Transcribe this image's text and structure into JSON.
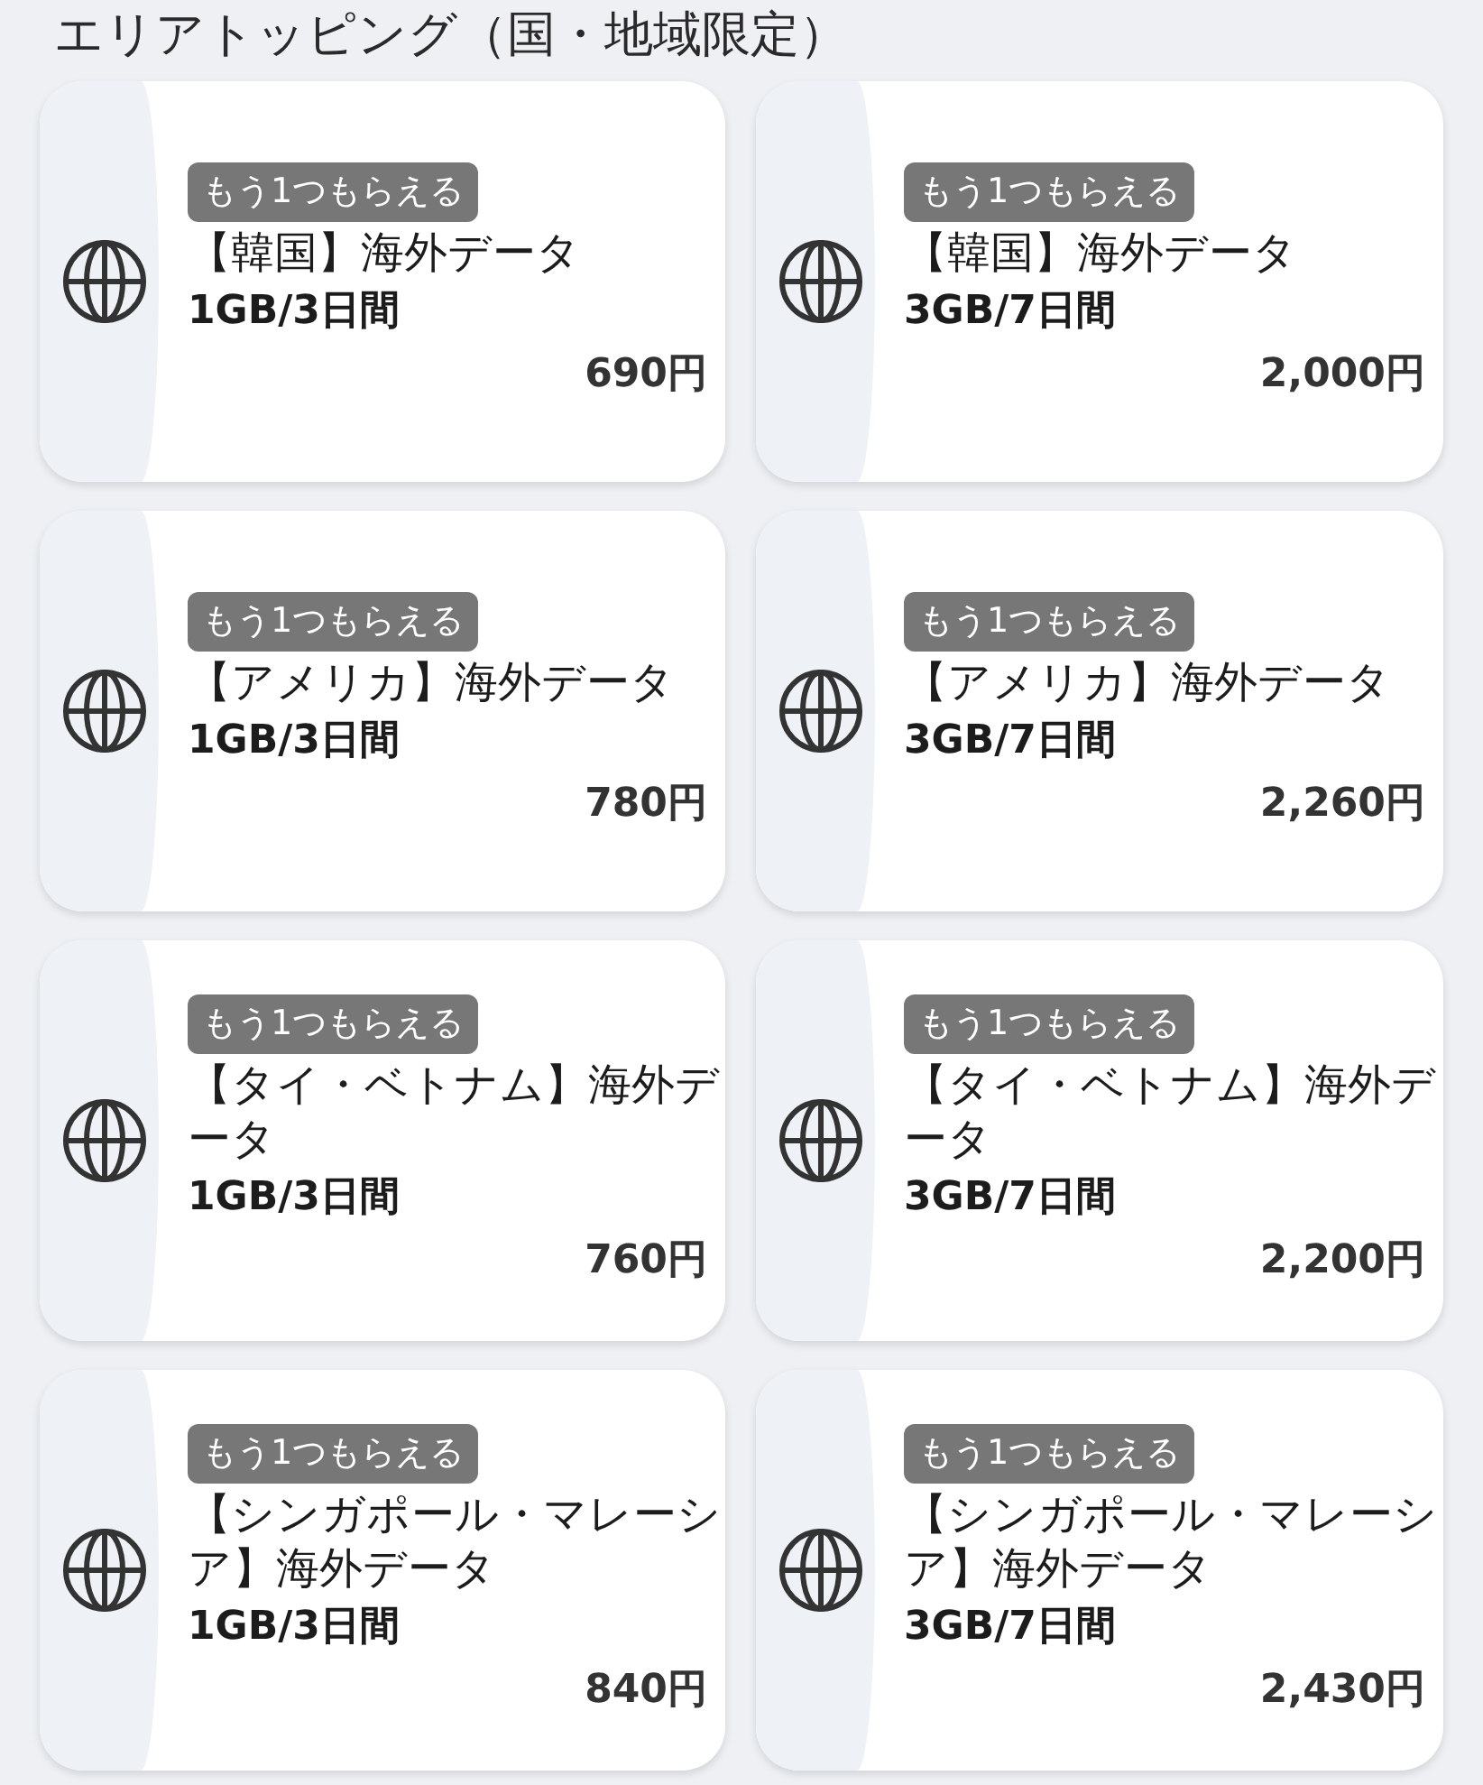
{
  "heading": "エリアトッピング（国・地域限定）",
  "cards": [
    {
      "badge": "もう1つもらえる",
      "title": "【韓国】海外データ",
      "plan": "1GB/3日間",
      "price": "690円"
    },
    {
      "badge": "もう1つもらえる",
      "title": "【韓国】海外データ",
      "plan": "3GB/7日間",
      "price": "2,000円"
    },
    {
      "badge": "もう1つもらえる",
      "title": "【アメリカ】海外データ",
      "plan": "1GB/3日間",
      "price": "780円"
    },
    {
      "badge": "もう1つもらえる",
      "title": "【アメリカ】海外データ",
      "plan": "3GB/7日間",
      "price": "2,260円"
    },
    {
      "badge": "もう1つもらえる",
      "title": "【タイ・ベトナム】海外データ",
      "plan": "1GB/3日間",
      "price": "760円"
    },
    {
      "badge": "もう1つもらえる",
      "title": "【タイ・ベトナム】海外データ",
      "plan": "3GB/7日間",
      "price": "2,200円"
    },
    {
      "badge": "もう1つもらえる",
      "title": "【シンガポール・マレーシア】海外データ",
      "plan": "1GB/3日間",
      "price": "840円"
    },
    {
      "badge": "もう1つもらえる",
      "title": "【シンガポール・マレーシア】海外データ",
      "plan": "3GB/7日間",
      "price": "2,430円"
    }
  ]
}
